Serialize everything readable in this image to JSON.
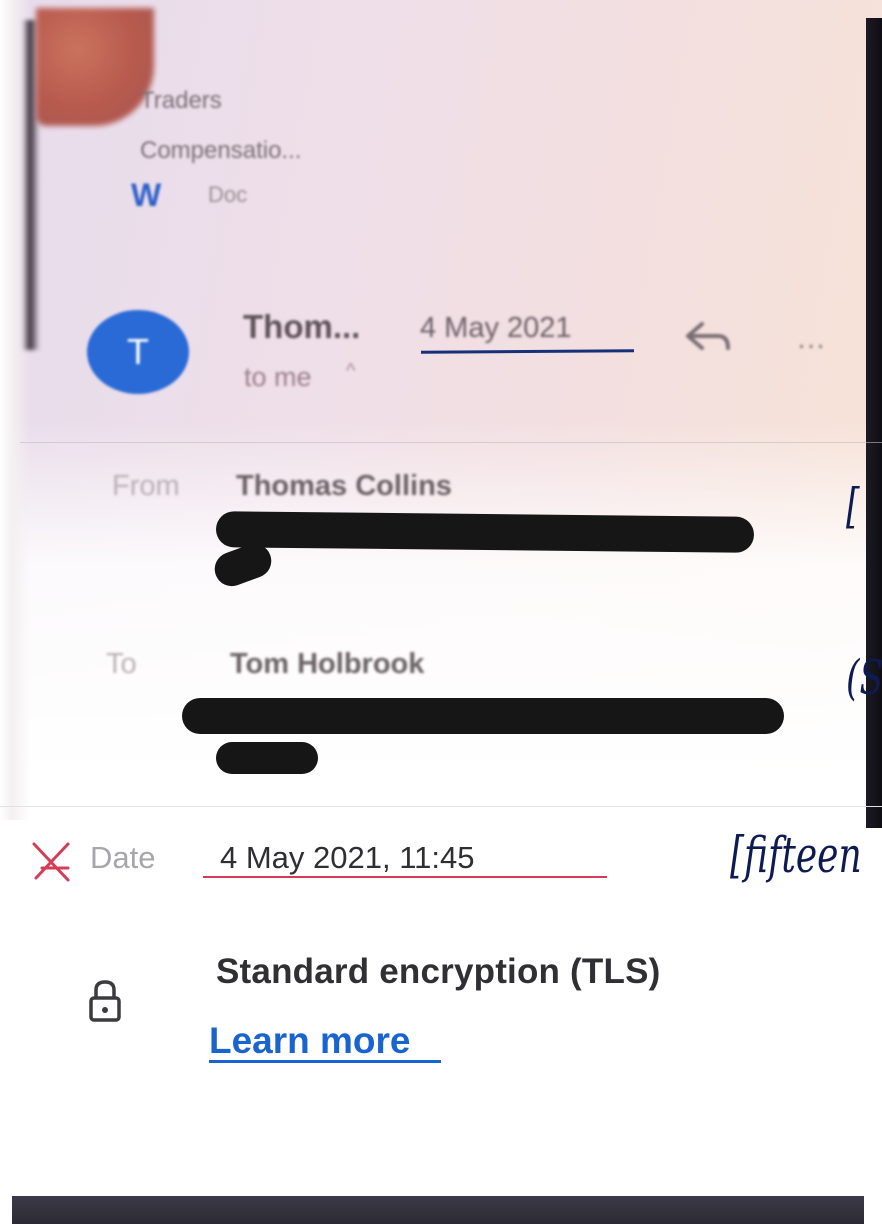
{
  "email": {
    "attachment": {
      "title": "Traders Compensatio...",
      "title_line1": "Traders",
      "title_line2": "Compensatio...",
      "type_letter": "W",
      "type_label": "Doc"
    },
    "header": {
      "avatar_letter": "T",
      "sender_short": "Thom...",
      "date": "4 May 2021",
      "recipient_summary": "to me",
      "recipient_caret": "^",
      "more_glyph": "…"
    },
    "details": {
      "from_label": "From",
      "from_name": "Thomas Collins",
      "to_label": "To",
      "to_name": "Tom Holbrook",
      "date_label": "Date",
      "date_value": "4 May 2021, 11:45",
      "security_text": "Standard encryption (TLS)",
      "learn_more": "Learn more"
    }
  },
  "annotations": {
    "from_note": "[",
    "to_note": "(S",
    "date_note": "[fifteen",
    "ink_color": "#0e1a52",
    "mark_color": "#d43c57"
  },
  "colors": {
    "avatar": "#2a6ad6",
    "link": "#1a64d0",
    "date_underline": "#17307a"
  }
}
